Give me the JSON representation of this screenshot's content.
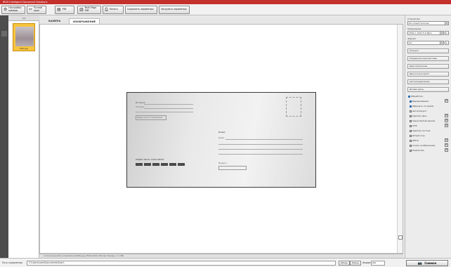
{
  "window": {
    "title": "iRUS Intelligent Document Solutions"
  },
  "toolbar": {
    "buttons": [
      {
        "icon": "gear-icon",
        "glyph": "⚙",
        "label": "Настройки\nкамеры"
      },
      {
        "icon": "crop-icon",
        "glyph": "✂",
        "label": "Ручной\nкроп"
      },
      {
        "icon": "pdf-icon",
        "glyph": "▤",
        "label": "PDF"
      },
      {
        "icon": "multipage-pdf-icon",
        "glyph": "▥",
        "label": "Multi Page\nPDF"
      },
      {
        "icon": "print-icon",
        "glyph": "⎙",
        "label": "Печать"
      },
      {
        "icon": "save-params-icon",
        "glyph": "",
        "label": "Сохранить параметры"
      },
      {
        "icon": "reset-params-icon",
        "glyph": "",
        "label": "Загрузить параметры"
      }
    ]
  },
  "thumbnails": {
    "header": "1/1",
    "items": [
      {
        "caption": "IMG.jpg"
      }
    ]
  },
  "tabs": [
    {
      "label": "КАМЕРА"
    },
    {
      "label": "ИЗОБРАЖЕНИЕ"
    }
  ],
  "viewer": {
    "status": "C:\\Users\\user\\Documents\\Scan\\IMG.jpg   2592x1944   300 dpi   Размер: 1.1 MB",
    "envelope": {
      "from_label": "От кого:",
      "from_lines": [
        "Откуда:",
        "Индекс места отправления"
      ],
      "to_label": "Кому:",
      "to_lines": [
        "Куда:",
        "Индекс:"
      ],
      "index_text": "ИНДЕКС МЕСТА НАЗНАЧЕНИЯ"
    }
  },
  "right_panel": {
    "fields": [
      {
        "label": "Устройство",
        "value": "Document Scanner"
      },
      {
        "label": "Разрешение",
        "value": "2592 x 1944  5.0 Mpix"
      },
      {
        "label": "Формат",
        "value": "A4"
      }
    ],
    "groups": [
      "Поворот",
      "Коррекция перспективы",
      "Цветной режим",
      "Яркость/контраст",
      "Автоопределение",
      "Штамп даты"
    ],
    "processing": {
      "header": "Обработка",
      "options": [
        {
          "label": "Выравнивание",
          "checked": true,
          "gear": true
        },
        {
          "label": "Обрезать по краям",
          "checked": true,
          "gear": false
        },
        {
          "label": "Автоповорот",
          "checked": false,
          "gear": false
        },
        {
          "label": "Удалить фон",
          "checked": false,
          "gear": true
        },
        {
          "label": "Черно-белый режим",
          "checked": false,
          "gear": true
        },
        {
          "label": "OCR",
          "checked": false,
          "gear": true
        },
        {
          "label": "Удалить пустые",
          "checked": false,
          "gear": false
        },
        {
          "label": "Штрих-код",
          "checked": false,
          "gear": false
        },
        {
          "label": "PDF/A",
          "checked": false,
          "gear": true
        },
        {
          "label": "Сжать изображение",
          "checked": false,
          "gear": true
        },
        {
          "label": "Подписать",
          "checked": false,
          "gear": true
        }
      ]
    }
  },
  "bottom": {
    "save_label": "Путь сохранения",
    "save_path": "C:\\Users\\user\\Documents\\Scan\\",
    "open_label": "Обзор",
    "folder_label": "Папка",
    "format_label": "Формат",
    "format_value": "JPG",
    "scan_label": "Снимок"
  }
}
